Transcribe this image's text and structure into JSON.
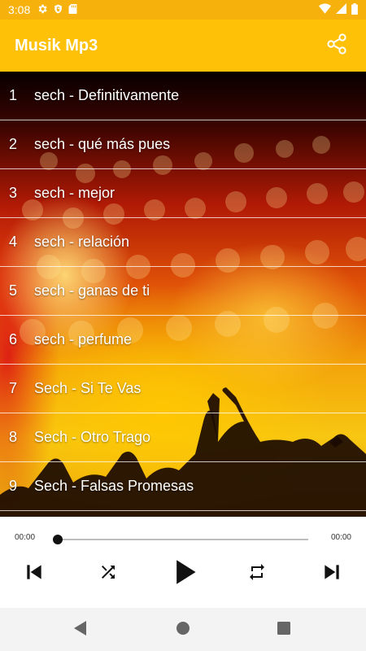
{
  "status_bar": {
    "time": "3:08",
    "icons_left": [
      "gear-icon",
      "shield-icon",
      "sd-card-icon"
    ],
    "icons_right": [
      "wifi-icon",
      "signal-icon",
      "battery-icon"
    ]
  },
  "app_bar": {
    "title": "Musik Mp3",
    "share_icon": "share-icon"
  },
  "songs": [
    {
      "number": "1",
      "title": "sech - Definitivamente"
    },
    {
      "number": "2",
      "title": "sech - qué más pues"
    },
    {
      "number": "3",
      "title": "sech - mejor"
    },
    {
      "number": "4",
      "title": "sech - relación"
    },
    {
      "number": "5",
      "title": "sech - ganas de ti"
    },
    {
      "number": "6",
      "title": "sech - perfume"
    },
    {
      "number": "7",
      "title": "Sech - Si Te Vas"
    },
    {
      "number": "8",
      "title": "Sech - Otro Trago"
    },
    {
      "number": "9",
      "title": "Sech - Falsas Promesas"
    }
  ],
  "player": {
    "current_time": "00:00",
    "total_time": "00:00",
    "progress": 0,
    "controls": [
      "skip-previous-icon",
      "shuffle-icon",
      "play-icon",
      "repeat-icon",
      "skip-next-icon"
    ]
  },
  "nav_bar": {
    "buttons": [
      "back-icon",
      "home-icon",
      "recents-icon"
    ]
  },
  "colors": {
    "app_bar": "#FFC107",
    "status_bar": "#F6B10C",
    "list_text": "#FFFFFF",
    "player_bg": "#FFFFFF"
  }
}
